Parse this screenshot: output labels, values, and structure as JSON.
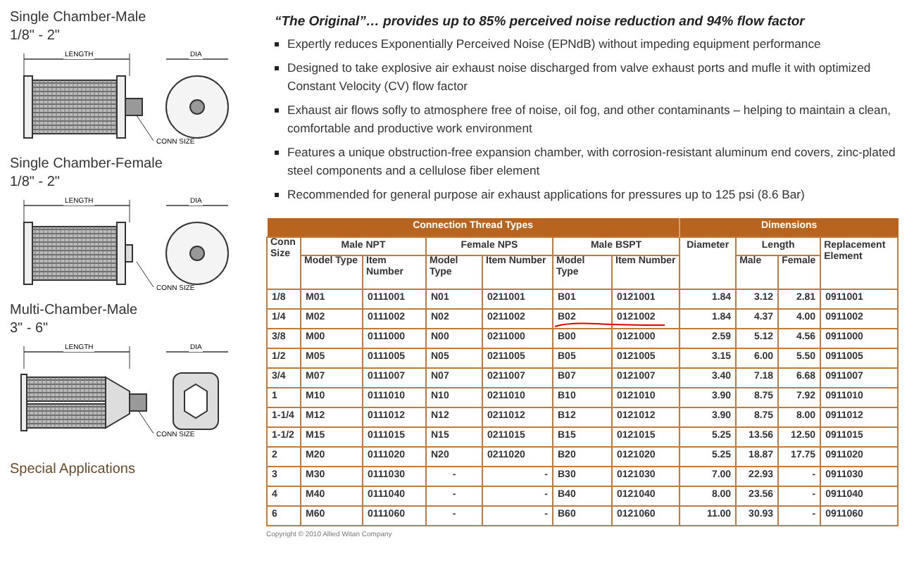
{
  "products": [
    {
      "kind": "single_male",
      "title": "Single Chamber-Male",
      "size": "1/8\" - 2\"",
      "length_label": "LENGTH",
      "dia_label": "DIA",
      "conn_label": "CONN SIZE"
    },
    {
      "kind": "single_female",
      "title": "Single Chamber-Female",
      "size": "1/8\" - 2\"",
      "length_label": "LENGTH",
      "dia_label": "DIA",
      "conn_label": "CONN SIZE"
    },
    {
      "kind": "multi_male",
      "title": "Multi-Chamber-Male",
      "size": "3\" - 6\"",
      "length_label": "LENGTH",
      "dia_label": "DIA",
      "conn_label": "CONN SIZE"
    }
  ],
  "special_applications": "Special Applications",
  "headline": "“The Original”… provides up to 85% perceived noise reduction and 94% flow factor",
  "bullets": [
    "Expertly reduces Exponentially Perceived Noise (EPNdB) without impeding equipment performance",
    "Designed to take explosive air exhaust noise discharged from valve exhaust ports and mufle it with optimized Constant Velocity (CV) flow factor",
    "Exhaust air flows sofly to atmosphere free of noise, oil fog, and other contaminants – helping to maintain a clean, comfortable and productive work environment",
    "Features a unique obstruction-free expansion chamber, with corrosion-resistant aluminum end covers, zinc-plated steel components and a cellulose fiber element",
    "Recommended for general purpose air exhaust applications for pressures up to 125 psi (8.6 Bar)"
  ],
  "table": {
    "group_headers": [
      "Connection Thread Types",
      "Dimensions"
    ],
    "conn_size": "Conn Size",
    "thread_types": [
      "Male NPT",
      "Female NPS",
      "Male BSPT"
    ],
    "diameter": "Diameter",
    "length": "Length",
    "replacement": "Replacement Element",
    "sub_headers": [
      "Model Type",
      "Item Number",
      "Model Type",
      "Item Number",
      "Model Type",
      "Item Number",
      "Male",
      "Female"
    ],
    "rows": [
      [
        "1/8",
        "M01",
        "0111001",
        "N01",
        "0211001",
        "B01",
        "0121001",
        "1.84",
        "3.12",
        "2.81",
        "0911001"
      ],
      [
        "1/4",
        "M02",
        "0111002",
        "N02",
        "0211002",
        "B02",
        "0121002",
        "1.84",
        "4.37",
        "4.00",
        "0911002"
      ],
      [
        "3/8",
        "M00",
        "0111000",
        "N00",
        "0211000",
        "B00",
        "0121000",
        "2.59",
        "5.12",
        "4.56",
        "0911000"
      ],
      [
        "1/2",
        "M05",
        "0111005",
        "N05",
        "0211005",
        "B05",
        "0121005",
        "3.15",
        "6.00",
        "5.50",
        "0911005"
      ],
      [
        "3/4",
        "M07",
        "0111007",
        "N07",
        "0211007",
        "B07",
        "0121007",
        "3.40",
        "7.18",
        "6.68",
        "0911007"
      ],
      [
        "1",
        "M10",
        "0111010",
        "N10",
        "0211010",
        "B10",
        "0121010",
        "3.90",
        "8.75",
        "7.92",
        "0911010"
      ],
      [
        "1-1/4",
        "M12",
        "0111012",
        "N12",
        "0211012",
        "B12",
        "0121012",
        "3.90",
        "8.75",
        "8.00",
        "0911012"
      ],
      [
        "1-1/2",
        "M15",
        "0111015",
        "N15",
        "0211015",
        "B15",
        "0121015",
        "5.25",
        "13.56",
        "12.50",
        "0911015"
      ],
      [
        "2",
        "M20",
        "0111020",
        "N20",
        "0211020",
        "B20",
        "0121020",
        "5.25",
        "18.87",
        "17.75",
        "0911020"
      ],
      [
        "3",
        "M30",
        "0111030",
        "-",
        "-",
        "B30",
        "0121030",
        "7.00",
        "22.93",
        "-",
        "0911030"
      ],
      [
        "4",
        "M40",
        "0111040",
        "-",
        "-",
        "B40",
        "0121040",
        "8.00",
        "23.56",
        "-",
        "0911040"
      ],
      [
        "6",
        "M60",
        "0111060",
        "-",
        "-",
        "B60",
        "0121060",
        "11.00",
        "30.93",
        "-",
        "0911060"
      ]
    ]
  },
  "copyright": "Copyright © 2010 Allied Witan Company"
}
